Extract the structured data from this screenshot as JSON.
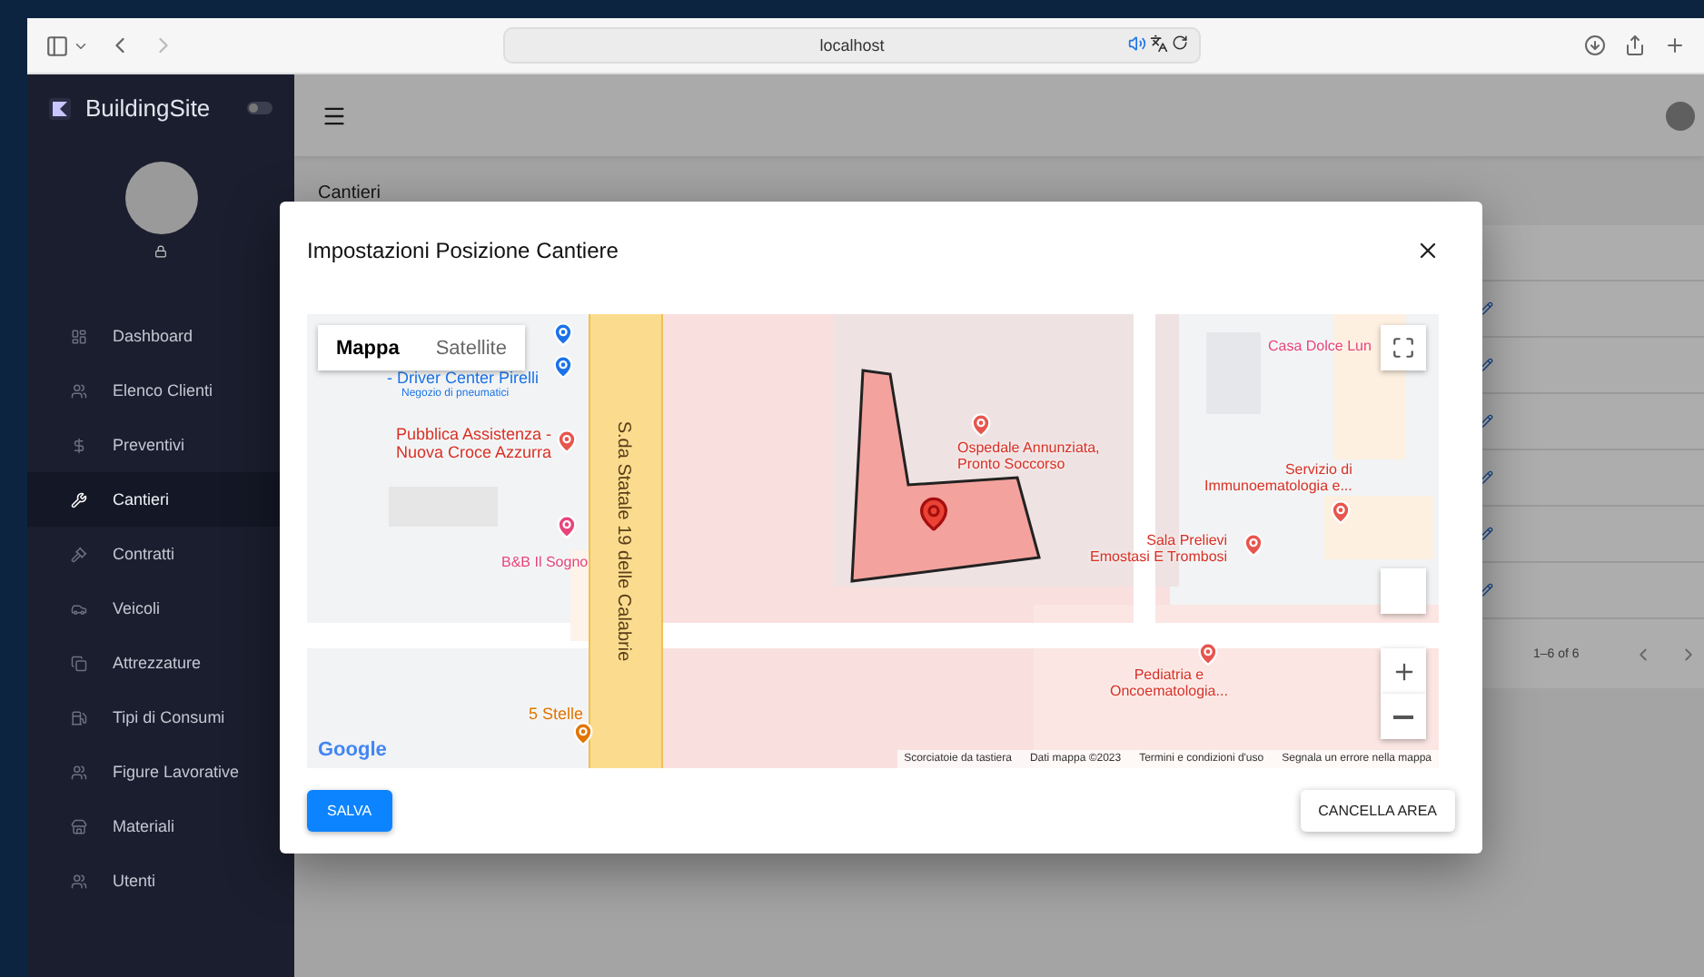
{
  "browser": {
    "url": "localhost"
  },
  "sidebar": {
    "brand": "BuildingSite",
    "theme_toggle": {
      "on": false
    },
    "items": [
      {
        "label": "Dashboard",
        "selected": false
      },
      {
        "label": "Elenco Clienti",
        "selected": false
      },
      {
        "label": "Preventivi",
        "selected": false
      },
      {
        "label": "Cantieri",
        "selected": true
      },
      {
        "label": "Contratti",
        "selected": false
      },
      {
        "label": "Veicoli",
        "selected": false
      },
      {
        "label": "Attrezzature",
        "selected": false
      },
      {
        "label": "Tipi di Consumi",
        "selected": false
      },
      {
        "label": "Figure Lavorative",
        "selected": false
      },
      {
        "label": "Materiali",
        "selected": false
      },
      {
        "label": "Utenti",
        "selected": false
      }
    ]
  },
  "page": {
    "title": "Cantieri",
    "pagination": "1–6 of 6"
  },
  "modal": {
    "title": "Impostazioni Posizione Cantiere",
    "map": {
      "map_types": [
        {
          "label": "Mappa",
          "selected": true
        },
        {
          "label": "Satellite",
          "selected": false
        }
      ],
      "street": "S.da Statale 19 delle Calabrie",
      "labels": [
        {
          "text": "- Driver Center Pirelli",
          "kind": "shop"
        },
        {
          "text": "Negozio di pneumatici",
          "kind": "shop-sub"
        },
        {
          "text": "Pubblica Assistenza -\nNuova Croce Azzurra",
          "kind": "health"
        },
        {
          "text": "B&B Il Sogno",
          "kind": "lodging"
        },
        {
          "text": "5 Stelle",
          "kind": "food"
        },
        {
          "text": "Ospedale Annunziata,\nPronto Soccorso",
          "kind": "health"
        },
        {
          "text": "Casa Dolce Lun",
          "kind": "lodging"
        },
        {
          "text": "Servizio di\nImmunoematologia e...",
          "kind": "health"
        },
        {
          "text": "Sala Prelievi\nEmostasi E Trombosi",
          "kind": "health"
        },
        {
          "text": "Pediatria e\nOncoematologia...",
          "kind": "health"
        }
      ],
      "logo": "Google",
      "attribution": [
        "Scorciatoie da tastiera",
        "Dati mappa ©2023",
        "Termini e condizioni d'uso",
        "Segnala un errore nella mappa"
      ]
    },
    "buttons": {
      "save": "SALVA",
      "clear": "CANCELLA AREA"
    }
  }
}
